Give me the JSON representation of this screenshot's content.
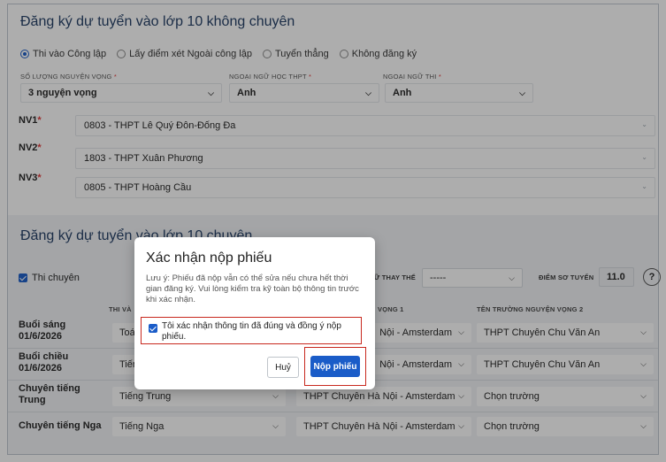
{
  "section1": {
    "title": "Đăng ký dự tuyển vào lớp 10 không chuyên",
    "radios": [
      {
        "label": "Thi vào Công lập",
        "selected": true
      },
      {
        "label": "Lấy điểm xét Ngoài công lập",
        "selected": false
      },
      {
        "label": "Tuyển thẳng",
        "selected": false
      },
      {
        "label": "Không đăng ký",
        "selected": false
      }
    ],
    "so_luong_label": "SỐ LƯỢNG NGUYỆN VỌNG",
    "so_luong_value": "3 nguyện vọng",
    "ngoai_ngu_hoc_label": "NGOẠI NGỮ HỌC THPT",
    "ngoai_ngu_hoc_value": "Anh",
    "ngoai_ngu_thi_label": "NGOẠI NGỮ THI",
    "ngoai_ngu_thi_value": "Anh",
    "required_mark": "*",
    "nv": [
      {
        "label": "NV1",
        "value": "0803 - THPT Lê Quý Đôn-Đống Đa"
      },
      {
        "label": "NV2",
        "value": "1803 - THPT Xuân Phương"
      },
      {
        "label": "NV3",
        "value": "0805 - THPT Hoàng Cầu"
      }
    ]
  },
  "section2": {
    "title": "Đăng ký dự tuyển vào lớp 10 chuyên",
    "thi_chuyen_label": "Thi chuyên",
    "thay_the_label": "Ữ THAY THẾ",
    "thay_the_value": "-----",
    "diem_so_tuyen_label": "ĐIỂM SƠ TUYỂN",
    "diem_so_tuyen_value": "11.0",
    "help_symbol": "?",
    "col_thi_vao": "THI VÀ",
    "col_vong1": "VỌNG 1",
    "col_ten_truong_nv2": "TÊN TRƯỜNG NGUYỆN VỌNG 2",
    "rows": [
      {
        "label": "Buổi sáng 01/6/2026",
        "mon": "Toá",
        "nv1": "Nội - Amsterdam",
        "nv2": "THPT Chuyên Chu Văn An"
      },
      {
        "label": "Buổi chiều 01/6/2026",
        "mon": "Tiến",
        "nv1": "Nội - Amsterdam",
        "nv2": "THPT Chuyên Chu Văn An"
      },
      {
        "label": "Chuyên tiếng Trung",
        "mon": "Tiếng Trung",
        "nv1": "THPT Chuyên Hà Nội - Amsterdam",
        "nv2": "Chọn trường"
      },
      {
        "label": "Chuyên tiếng Nga",
        "mon": "Tiếng Nga",
        "nv1": "THPT Chuyên Hà Nội - Amsterdam",
        "nv2": "Chọn trường"
      }
    ]
  },
  "modal": {
    "title": "Xác nhận nộp phiếu",
    "note": "Lưu ý: Phiếu đã nộp vẫn có thể sửa nếu chưa hết thời gian đăng ký. Vui lòng kiểm tra kỹ toàn bộ thông tin trước khi xác nhận.",
    "confirm_text": "Tôi xác nhận thông tin đã đúng và đồng ý nộp phiếu.",
    "confirm_checked": true,
    "cancel_label": "Huỷ",
    "submit_label": "Nộp phiếu"
  },
  "colors": {
    "primary": "#1a5cc8",
    "title": "#1f3b63",
    "highlight": "#c8281e"
  }
}
